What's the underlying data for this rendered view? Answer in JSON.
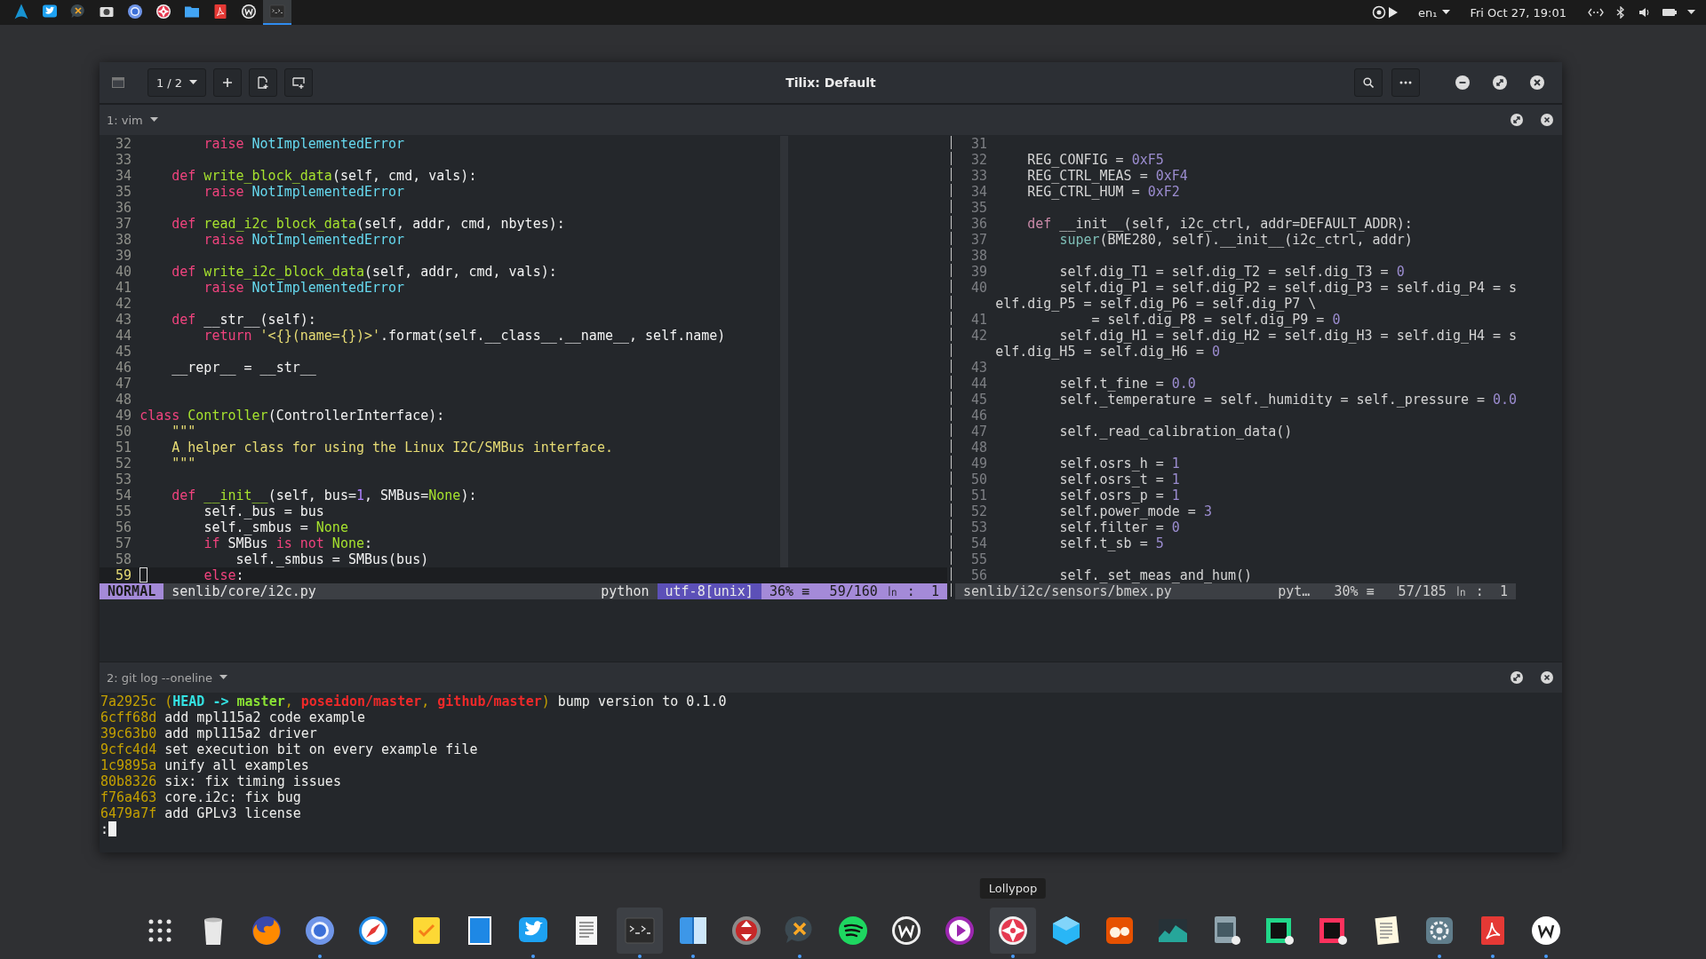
{
  "top_panel": {
    "apps": [
      {
        "kind": "logo",
        "selected": false
      },
      {
        "kind": "bird",
        "selected": false
      },
      {
        "kind": "bubble",
        "selected": false
      },
      {
        "kind": "camera",
        "selected": false
      },
      {
        "kind": "ring",
        "selected": false
      },
      {
        "kind": "candy",
        "selected": false
      },
      {
        "kind": "folder",
        "selected": false
      },
      {
        "kind": "pdf",
        "selected": false
      },
      {
        "kind": "wletter",
        "selected": false
      },
      {
        "kind": "terminal",
        "selected": true
      }
    ],
    "language": "en₁",
    "clock": "Fri Oct 27, 19:01"
  },
  "window": {
    "title": "Tilix: Default",
    "session": "1 / 2",
    "terminals": [
      {
        "title": "1: vim",
        "panes": [
          {
            "active": true,
            "lines": [
              {
                "number": "32",
                "current": false,
                "tokens": [
                  {
                    "kind": "keyword",
                    "text": "        raise"
                  },
                  {
                    "kind": "type",
                    "text": " NotImplementedError"
                  }
                ]
              },
              {
                "number": "33",
                "current": false
              },
              {
                "number": "34",
                "current": false,
                "tokens": [
                  {
                    "kind": "keyword",
                    "text": "    def"
                  },
                  {
                    "kind": "function",
                    "text": " write_block_data"
                  },
                  {
                    "kind": "plain",
                    "text": "(self, cmd, vals):"
                  }
                ]
              },
              {
                "number": "35",
                "current": false,
                "tokens": [
                  {
                    "kind": "keyword",
                    "text": "        raise"
                  },
                  {
                    "kind": "type",
                    "text": " NotImplementedError"
                  }
                ]
              },
              {
                "number": "36",
                "current": false
              },
              {
                "number": "37",
                "current": false,
                "tokens": [
                  {
                    "kind": "keyword",
                    "text": "    def"
                  },
                  {
                    "kind": "function",
                    "text": " read_i2c_block_data"
                  },
                  {
                    "kind": "plain",
                    "text": "(self, addr, cmd, nbytes):"
                  }
                ]
              },
              {
                "number": "38",
                "current": false,
                "tokens": [
                  {
                    "kind": "keyword",
                    "text": "        raise"
                  },
                  {
                    "kind": "type",
                    "text": " NotImplementedError"
                  }
                ]
              },
              {
                "number": "39",
                "current": false
              },
              {
                "number": "40",
                "current": false,
                "tokens": [
                  {
                    "kind": "keyword",
                    "text": "    def"
                  },
                  {
                    "kind": "function",
                    "text": " write_i2c_block_data"
                  },
                  {
                    "kind": "plain",
                    "text": "(self, addr, cmd, vals):"
                  }
                ]
              },
              {
                "number": "41",
                "current": false,
                "tokens": [
                  {
                    "kind": "keyword",
                    "text": "        raise"
                  },
                  {
                    "kind": "type",
                    "text": " NotImplementedError"
                  }
                ]
              },
              {
                "number": "42",
                "current": false
              },
              {
                "number": "43",
                "current": false,
                "tokens": [
                  {
                    "kind": "keyword",
                    "text": "    def"
                  },
                  {
                    "kind": "plain",
                    "text": " __str__(self):"
                  }
                ]
              },
              {
                "number": "44",
                "current": false,
                "tokens": [
                  {
                    "kind": "keyword",
                    "text": "        return"
                  },
                  {
                    "kind": "string",
                    "text": " '<{}(name={})>'"
                  },
                  {
                    "kind": "plain",
                    "text": ".format(self.__class__.__name__, self.name)"
                  }
                ]
              },
              {
                "number": "45",
                "current": false
              },
              {
                "number": "46",
                "current": false,
                "tokens": [
                  {
                    "kind": "plain",
                    "text": "    __repr__ = __str__"
                  }
                ]
              },
              {
                "number": "47",
                "current": false
              },
              {
                "number": "48",
                "current": false
              },
              {
                "number": "49",
                "current": false,
                "tokens": [
                  {
                    "kind": "keyword",
                    "text": "class"
                  },
                  {
                    "kind": "function",
                    "text": " Controller"
                  },
                  {
                    "kind": "plain",
                    "text": "(ControllerInterface):"
                  }
                ]
              },
              {
                "number": "50",
                "current": false,
                "tokens": [
                  {
                    "kind": "string",
                    "text": "    \"\"\""
                  }
                ]
              },
              {
                "number": "51",
                "current": false,
                "tokens": [
                  {
                    "kind": "string",
                    "text": "    A helper class for using the Linux I2C/SMBus interface."
                  }
                ]
              },
              {
                "number": "52",
                "current": false,
                "tokens": [
                  {
                    "kind": "string",
                    "text": "    \"\"\""
                  }
                ]
              },
              {
                "number": "53",
                "current": false
              },
              {
                "number": "54",
                "current": false,
                "tokens": [
                  {
                    "kind": "keyword",
                    "text": "    def"
                  },
                  {
                    "kind": "function",
                    "text": " __init__"
                  },
                  {
                    "kind": "plain",
                    "text": "(self, bus="
                  },
                  {
                    "kind": "number",
                    "text": "1"
                  },
                  {
                    "kind": "plain",
                    "text": ", SMBus="
                  },
                  {
                    "kind": "constant",
                    "text": "None"
                  },
                  {
                    "kind": "plain",
                    "text": "):"
                  }
                ]
              },
              {
                "number": "55",
                "current": false,
                "tokens": [
                  {
                    "kind": "plain",
                    "text": "        self._bus = bus"
                  }
                ]
              },
              {
                "number": "56",
                "current": false,
                "tokens": [
                  {
                    "kind": "plain",
                    "text": "        self._smbus = "
                  },
                  {
                    "kind": "constant",
                    "text": "None"
                  }
                ]
              },
              {
                "number": "57",
                "current": false,
                "tokens": [
                  {
                    "kind": "keyword",
                    "text": "        if"
                  },
                  {
                    "kind": "plain",
                    "text": " SMBus "
                  },
                  {
                    "kind": "keyword",
                    "text": "is not"
                  },
                  {
                    "kind": "constant",
                    "text": " None"
                  },
                  {
                    "kind": "plain",
                    "text": ":"
                  }
                ]
              },
              {
                "number": "58",
                "current": false,
                "tokens": [
                  {
                    "kind": "plain",
                    "text": "            self._smbus = SMBus(bus)"
                  }
                ]
              },
              {
                "number": "59",
                "current": true,
                "tokens": [
                  {
                    "kind": "keyword",
                    "text": "        else"
                  },
                  {
                    "kind": "plain",
                    "text": ":"
                  }
                ]
              }
            ],
            "status": {
              "mode": "NORMAL",
              "file": "senlib/core/i2c.py",
              "filetype": "python",
              "encoding": "utf-8[unix]",
              "percent": "36% ≡",
              "position": "59/160 ㏑ :  1"
            }
          },
          {
            "active": false,
            "lines": [
              {
                "number": "31"
              },
              {
                "number": "32",
                "tokens": [
                  {
                    "kind": "plain",
                    "text": "    REG_CONFIG = "
                  },
                  {
                    "kind": "number",
                    "text": "0xF5"
                  }
                ]
              },
              {
                "number": "33",
                "tokens": [
                  {
                    "kind": "plain",
                    "text": "    REG_CTRL_MEAS = "
                  },
                  {
                    "kind": "number",
                    "text": "0xF4"
                  }
                ]
              },
              {
                "number": "34",
                "tokens": [
                  {
                    "kind": "plain",
                    "text": "    REG_CTRL_HUM = "
                  },
                  {
                    "kind": "number",
                    "text": "0xF2"
                  }
                ]
              },
              {
                "number": "35"
              },
              {
                "number": "36",
                "tokens": [
                  {
                    "kind": "keyword",
                    "text": "    def"
                  },
                  {
                    "kind": "plain",
                    "text": " __init__(self, i2c_ctrl, addr=DEFAULT_ADDR):"
                  }
                ]
              },
              {
                "number": "37",
                "tokens": [
                  {
                    "kind": "builtin",
                    "text": "        super"
                  },
                  {
                    "kind": "plain",
                    "text": "(BME280, self).__init__(i2c_ctrl, addr)"
                  }
                ]
              },
              {
                "number": "38"
              },
              {
                "number": "39",
                "tokens": [
                  {
                    "kind": "plain",
                    "text": "        self.dig_T1 = self.dig_T2 = self.dig_T3 = "
                  },
                  {
                    "kind": "number",
                    "text": "0"
                  }
                ]
              },
              {
                "number": "40",
                "tokens": [
                  {
                    "kind": "plain",
                    "text": "        self.dig_P1 = self.dig_P2 = self.dig_P3 = self.dig_P4 = s"
                  }
                ]
              },
              {
                "tokens": [
                  {
                    "kind": "plain",
                    "text": "elf.dig_P5 = self.dig_P6 = self.dig_P7 \\"
                  }
                ]
              },
              {
                "number": "41",
                "tokens": [
                  {
                    "kind": "plain",
                    "text": "            = self.dig_P8 = self.dig_P9 = "
                  },
                  {
                    "kind": "number",
                    "text": "0"
                  }
                ]
              },
              {
                "number": "42",
                "tokens": [
                  {
                    "kind": "plain",
                    "text": "        self.dig_H1 = self.dig_H2 = self.dig_H3 = self.dig_H4 = s"
                  }
                ]
              },
              {
                "tokens": [
                  {
                    "kind": "plain",
                    "text": "elf.dig_H5 = self.dig_H6 = "
                  },
                  {
                    "kind": "number",
                    "text": "0"
                  }
                ]
              },
              {
                "number": "43"
              },
              {
                "number": "44",
                "tokens": [
                  {
                    "kind": "plain",
                    "text": "        self.t_fine = "
                  },
                  {
                    "kind": "number",
                    "text": "0.0"
                  }
                ]
              },
              {
                "number": "45",
                "tokens": [
                  {
                    "kind": "plain",
                    "text": "        self._temperature = self._humidity = self._pressure = "
                  },
                  {
                    "kind": "number",
                    "text": "0.0"
                  }
                ]
              },
              {
                "number": "46"
              },
              {
                "number": "47",
                "tokens": [
                  {
                    "kind": "plain",
                    "text": "        self._read_calibration_data()"
                  }
                ]
              },
              {
                "number": "48"
              },
              {
                "number": "49",
                "tokens": [
                  {
                    "kind": "plain",
                    "text": "        self.osrs_h = "
                  },
                  {
                    "kind": "number",
                    "text": "1"
                  }
                ]
              },
              {
                "number": "50",
                "tokens": [
                  {
                    "kind": "plain",
                    "text": "        self.osrs_t = "
                  },
                  {
                    "kind": "number",
                    "text": "1"
                  }
                ]
              },
              {
                "number": "51",
                "tokens": [
                  {
                    "kind": "plain",
                    "text": "        self.osrs_p = "
                  },
                  {
                    "kind": "number",
                    "text": "1"
                  }
                ]
              },
              {
                "number": "52",
                "tokens": [
                  {
                    "kind": "plain",
                    "text": "        self.power_mode = "
                  },
                  {
                    "kind": "number",
                    "text": "3"
                  }
                ]
              },
              {
                "number": "53",
                "tokens": [
                  {
                    "kind": "plain",
                    "text": "        self.filter = "
                  },
                  {
                    "kind": "number",
                    "text": "0"
                  }
                ]
              },
              {
                "number": "54",
                "tokens": [
                  {
                    "kind": "plain",
                    "text": "        self.t_sb = "
                  },
                  {
                    "kind": "number",
                    "text": "5"
                  }
                ]
              },
              {
                "number": "55"
              },
              {
                "number": "56",
                "tokens": [
                  {
                    "kind": "plain",
                    "text": "        self._set_meas_and_hum()"
                  }
                ]
              }
            ],
            "status": {
              "file": "senlib/i2c/sensors/bmex.py",
              "filetype": "pyt…",
              "percent": "30% ≡",
              "position": "57/185 ㏑ :  1"
            }
          }
        ]
      },
      {
        "title": "2: git log --oneline",
        "output": [
          [
            {
              "kind": "hash",
              "text": "7a2925c"
            },
            {
              "kind": "paren",
              "text": " ("
            },
            {
              "kind": "head",
              "text": "HEAD -> "
            },
            {
              "kind": "branch",
              "text": "master"
            },
            {
              "kind": "paren",
              "text": ", "
            },
            {
              "kind": "remote",
              "text": "poseidon/master"
            },
            {
              "kind": "paren",
              "text": ", "
            },
            {
              "kind": "remote",
              "text": "github/master"
            },
            {
              "kind": "paren",
              "text": ")"
            },
            {
              "kind": "plain",
              "text": " bump version to 0.1.0"
            }
          ],
          [
            {
              "kind": "hash",
              "text": "6cff68d"
            },
            {
              "kind": "plain",
              "text": " add mpl115a2 code example"
            }
          ],
          [
            {
              "kind": "hash",
              "text": "39c63b0"
            },
            {
              "kind": "plain",
              "text": " add mpl115a2 driver"
            }
          ],
          [
            {
              "kind": "hash",
              "text": "9cfc4d4"
            },
            {
              "kind": "plain",
              "text": " set execution bit on every example file"
            }
          ],
          [
            {
              "kind": "hash",
              "text": "1c9895a"
            },
            {
              "kind": "plain",
              "text": " unify all examples"
            }
          ],
          [
            {
              "kind": "hash",
              "text": "80b8326"
            },
            {
              "kind": "plain",
              "text": " six: fix timing issues"
            }
          ],
          [
            {
              "kind": "hash",
              "text": "f76a463"
            },
            {
              "kind": "plain",
              "text": " core.i2c: fix bug"
            }
          ],
          [
            {
              "kind": "hash",
              "text": "6479a7f"
            },
            {
              "kind": "plain",
              "text": " add GPLv3 license"
            }
          ]
        ],
        "prompt": ":"
      }
    ]
  },
  "dock": {
    "items": [
      {
        "kind": "grid",
        "running": false,
        "highlighted": false
      },
      {
        "kind": "trash",
        "running": false,
        "highlighted": false
      },
      {
        "kind": "fox",
        "running": false,
        "highlighted": false
      },
      {
        "kind": "ring",
        "running": true,
        "highlighted": false
      },
      {
        "kind": "compass",
        "running": false,
        "highlighted": false
      },
      {
        "kind": "notepad",
        "running": false,
        "highlighted": false
      },
      {
        "kind": "stamp",
        "running": false,
        "highlighted": false
      },
      {
        "kind": "bird",
        "running": true,
        "highlighted": false
      },
      {
        "kind": "document",
        "running": false,
        "highlighted": false
      },
      {
        "kind": "terminal",
        "running": true,
        "highlighted": true
      },
      {
        "kind": "finder",
        "running": true,
        "highlighted": false
      },
      {
        "kind": "arrows",
        "running": false,
        "highlighted": false
      },
      {
        "kind": "bubble",
        "running": true,
        "highlighted": false
      },
      {
        "kind": "waves",
        "running": false,
        "highlighted": false
      },
      {
        "kind": "wletter",
        "running": false,
        "highlighted": false
      },
      {
        "kind": "play",
        "running": false,
        "highlighted": false
      },
      {
        "kind": "candy",
        "running": true,
        "highlighted": true,
        "tooltip": "Lollypop"
      },
      {
        "kind": "cube",
        "running": false,
        "highlighted": false
      },
      {
        "kind": "critter",
        "running": false,
        "highlighted": false
      },
      {
        "kind": "chart",
        "running": false,
        "highlighted": false
      },
      {
        "kind": "braces",
        "running": false,
        "highlighted": false
      },
      {
        "kind": "pc",
        "running": false,
        "highlighted": false
      },
      {
        "kind": "ij",
        "running": false,
        "highlighted": false
      },
      {
        "kind": "notes",
        "running": false,
        "highlighted": false
      },
      {
        "kind": "gear",
        "running": true,
        "highlighted": false
      },
      {
        "kind": "pdf",
        "running": true,
        "highlighted": false
      },
      {
        "kind": "wcircle",
        "running": true,
        "highlighted": false
      }
    ]
  }
}
